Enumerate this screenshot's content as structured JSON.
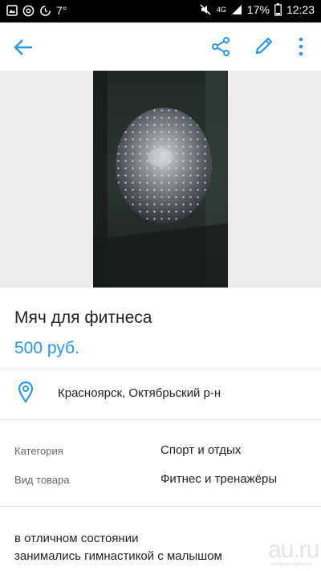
{
  "status_bar": {
    "temperature": "7°",
    "network": "4G",
    "battery": "17%",
    "time": "12:23"
  },
  "app_bar": {
    "icons": [
      "back-arrow-icon",
      "share-icon",
      "edit-pencil-icon",
      "more-vert-icon"
    ],
    "accent_color": "#2b96e0"
  },
  "listing": {
    "title": "Мяч для фитнеса",
    "price": "500 руб.",
    "location": "Красноярск, Октябрьский р-н"
  },
  "params": [
    {
      "label": "Категория",
      "value": "Спорт и отдых"
    },
    {
      "label": "Вид товара",
      "value": "Фитнес и тренажёры"
    }
  ],
  "description": {
    "line1": "в отличном состоянии",
    "line2": "занимались гимнастикой с малышом"
  },
  "watermark": {
    "logo": "au.ru",
    "sub": "интернет-аукцион"
  }
}
